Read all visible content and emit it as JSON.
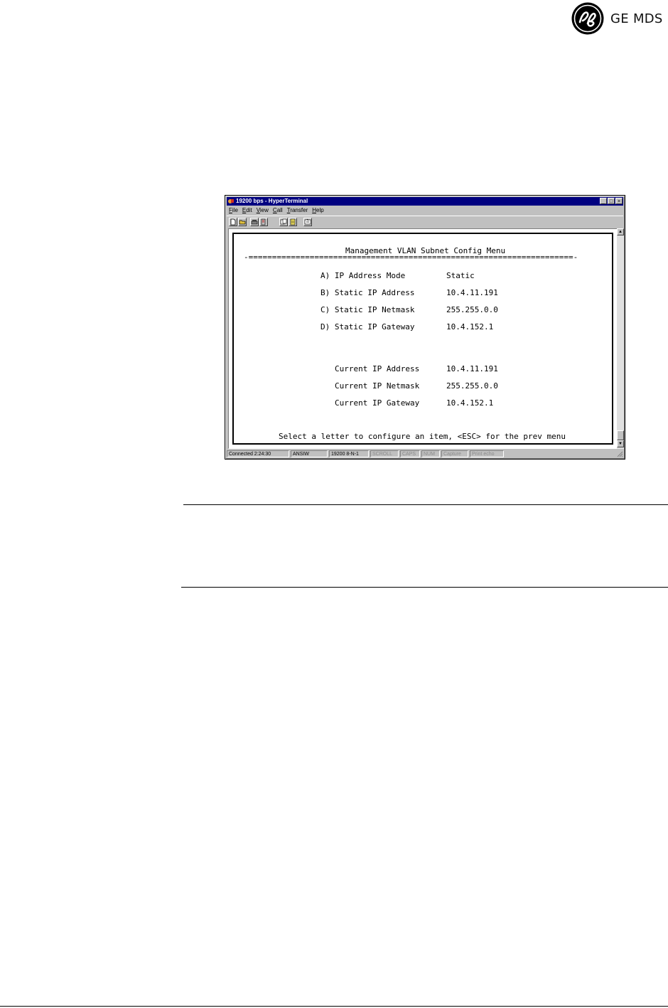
{
  "brand": {
    "name": "GE MDS",
    "logo": "ge-monogram-icon"
  },
  "window": {
    "title": "19200 bps - HyperTerminal",
    "menu": [
      "File",
      "Edit",
      "View",
      "Call",
      "Transfer",
      "Help"
    ],
    "controls": {
      "minimize": "_",
      "maximize": "□",
      "close": "×"
    }
  },
  "terminal": {
    "heading": "Management VLAN Subnet Config Menu",
    "separator": "-=====================================================================-",
    "options": [
      {
        "label": "A) IP Address Mode",
        "value": "Static"
      },
      {
        "label": "B) Static IP Address",
        "value": "10.4.11.191"
      },
      {
        "label": "C) Static IP Netmask",
        "value": "255.255.0.0"
      },
      {
        "label": "D) Static IP Gateway",
        "value": "10.4.152.1"
      }
    ],
    "current": [
      {
        "label": "Current IP Address",
        "value": "10.4.11.191"
      },
      {
        "label": "Current IP Netmask",
        "value": "255.255.0.0"
      },
      {
        "label": "Current IP Gateway",
        "value": "10.4.152.1"
      }
    ],
    "prompt": "Select a letter to configure an item, <ESC> for the prev menu"
  },
  "status": {
    "connected": "Connected 2:24:30",
    "emulation": "ANSIW",
    "port": "19200 8-N-1",
    "scroll": "SCROLL",
    "caps": "CAPS",
    "num": "NUM",
    "capture": "Capture",
    "print_echo": "Print echo"
  }
}
